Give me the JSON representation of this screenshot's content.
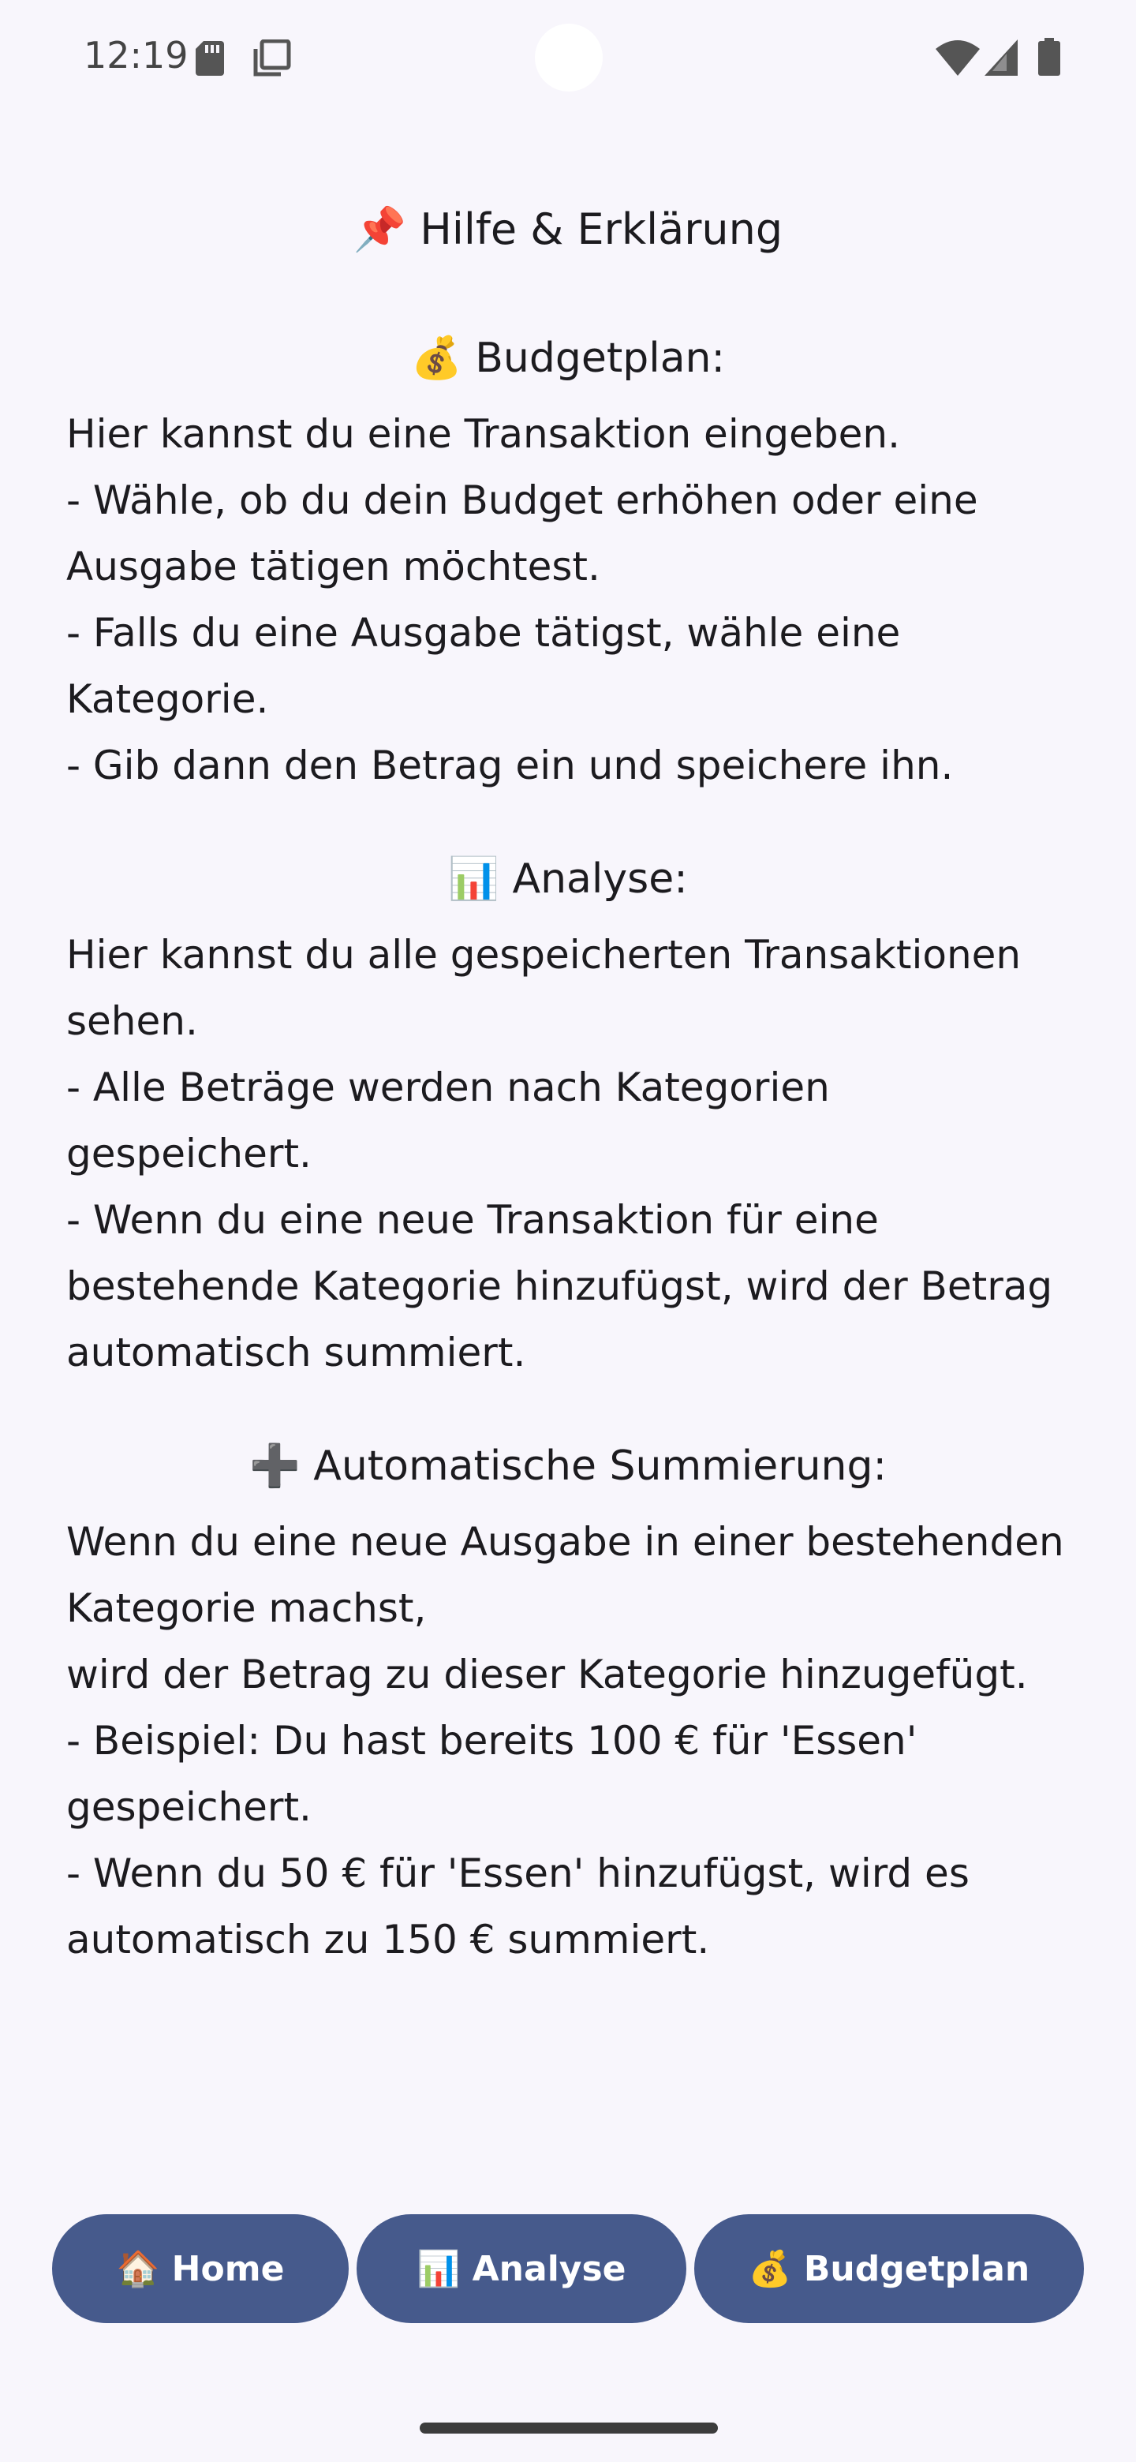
{
  "status_bar": {
    "time": "12:19",
    "icons": [
      "sd-card-icon",
      "copy-icon",
      "wifi-icon",
      "signal-icon",
      "battery-icon"
    ]
  },
  "page": {
    "title": "📌 Hilfe & Erklärung"
  },
  "sections": [
    {
      "title": "💰 Budgetplan:",
      "body": "Hier kannst du eine Transaktion eingeben.\n- Wähle, ob du dein Budget erhöhen oder eine Ausgabe tätigen möchtest.\n- Falls du eine Ausgabe tätigst, wähle eine Kategorie.\n- Gib dann den Betrag ein und speichere ihn."
    },
    {
      "title": "📊 Analyse:",
      "body": "Hier kannst du alle gespeicherten Transaktionen sehen.\n- Alle Beträge werden nach Kategorien gespeichert.\n- Wenn du eine neue Transaktion für eine bestehende Kategorie hinzufügst, wird der Betrag automatisch summiert."
    },
    {
      "title": "➕ Automatische Summierung:",
      "body": "Wenn du eine neue Ausgabe in einer bestehenden Kategorie machst,\nwird der Betrag zu dieser Kategorie hinzugefügt.\n- Beispiel: Du hast bereits 100 € für 'Essen' gespeichert.\n- Wenn du 50 € für 'Essen' hinzufügst, wird es automatisch zu 150 € summiert."
    }
  ],
  "nav": {
    "home": "🏠 Home",
    "analyse": "📊 Analyse",
    "budgetplan": "💰 Budgetplan"
  },
  "colors": {
    "background": "#f8f6fc",
    "nav_button": "#465a8c",
    "nav_text": "#ffffff",
    "text": "#1c1b1f"
  }
}
